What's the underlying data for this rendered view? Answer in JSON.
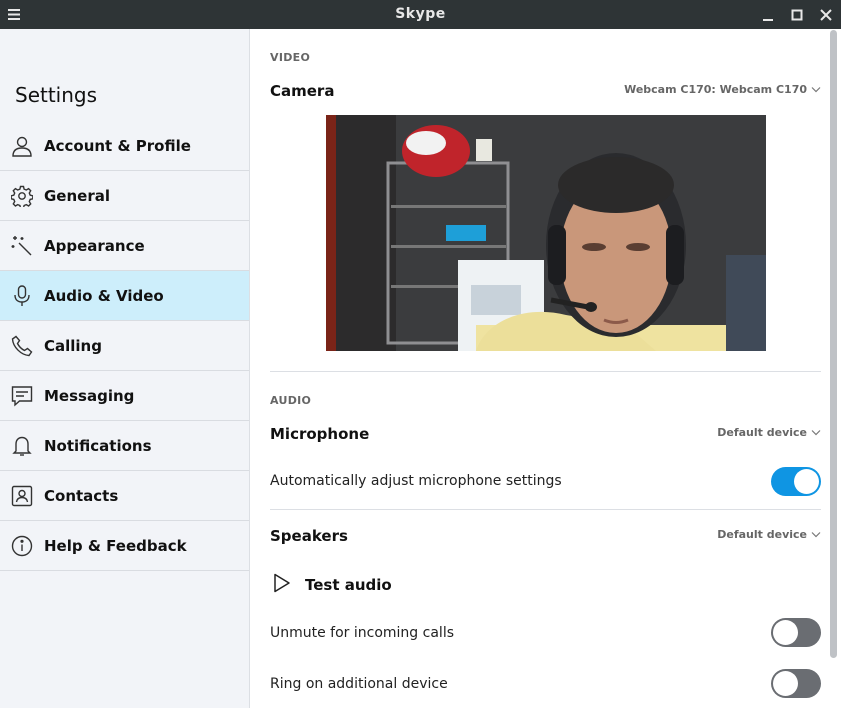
{
  "window": {
    "title": "Skype"
  },
  "sidebar": {
    "heading": "Settings",
    "items": [
      {
        "label": "Account & Profile",
        "icon": "person-icon"
      },
      {
        "label": "General",
        "icon": "gear-icon"
      },
      {
        "label": "Appearance",
        "icon": "magic-wand-icon"
      },
      {
        "label": "Audio & Video",
        "icon": "microphone-icon",
        "active": true
      },
      {
        "label": "Calling",
        "icon": "phone-icon"
      },
      {
        "label": "Messaging",
        "icon": "message-icon"
      },
      {
        "label": "Notifications",
        "icon": "bell-icon"
      },
      {
        "label": "Contacts",
        "icon": "contacts-icon"
      },
      {
        "label": "Help & Feedback",
        "icon": "info-icon"
      }
    ]
  },
  "video": {
    "section_label": "VIDEO",
    "camera_label": "Camera",
    "camera_device": "Webcam C170: Webcam C170"
  },
  "audio": {
    "section_label": "AUDIO",
    "microphone_label": "Microphone",
    "microphone_device": "Default device",
    "auto_adjust_label": "Automatically adjust microphone settings",
    "auto_adjust_on": true,
    "speakers_label": "Speakers",
    "speakers_device": "Default device",
    "test_audio_label": "Test audio",
    "unmute_label": "Unmute for incoming calls",
    "unmute_on": false,
    "ring_label": "Ring on additional device",
    "ring_on": false
  },
  "colors": {
    "accent": "#0f95e3",
    "active_nav": "#cdeefb",
    "titlebar": "#2e3436"
  }
}
